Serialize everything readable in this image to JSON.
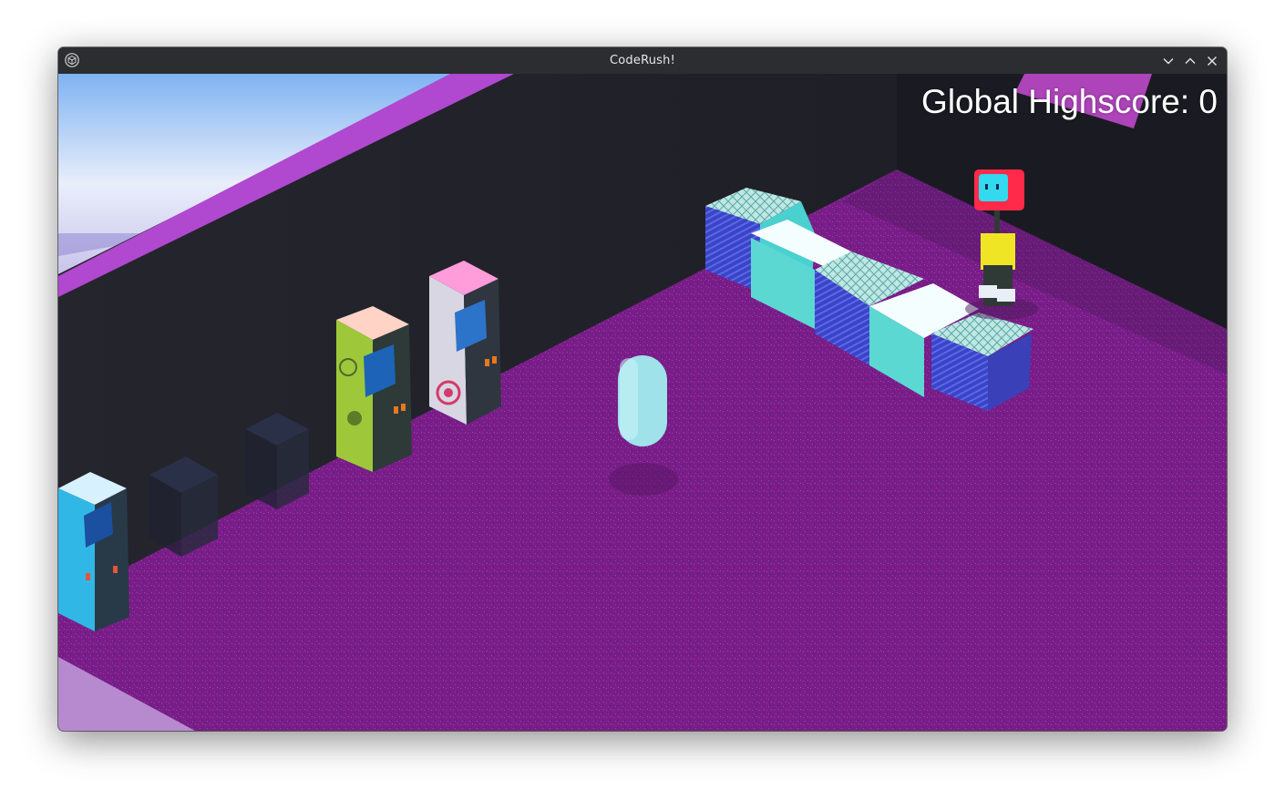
{
  "window": {
    "title": "CodeRush!",
    "app_icon": "app-cube-icon",
    "controls": [
      "minimize-icon",
      "maximize-icon",
      "close-icon"
    ]
  },
  "hud": {
    "global_highscore": "Global Highscore: 0"
  },
  "scene": {
    "description_colors": {
      "floor": "#7a1f8a",
      "back_wall": "#23242c",
      "sky": "#cdd9f0",
      "counter_top": "#5ed6cf",
      "counter_body": "#3a40b8"
    },
    "arcade_cabinets": 3,
    "objects": [
      "arcade-cabinet-blue",
      "arcade-cabinet-green",
      "arcade-cabinet-pink",
      "capsule-player",
      "service-counter",
      "tv-head-character"
    ]
  }
}
